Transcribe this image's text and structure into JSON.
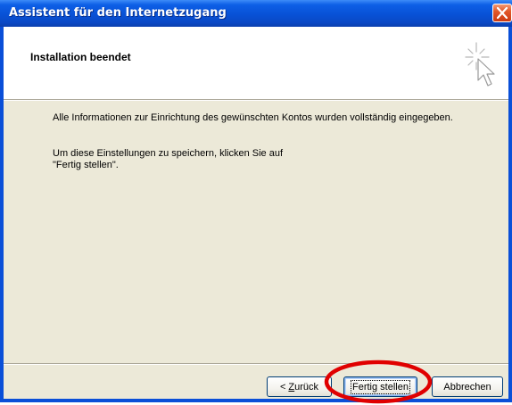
{
  "window": {
    "title": "Assistent für den Internetzugang"
  },
  "header": {
    "title": "Installation beendet",
    "icon": "wizard-cursor-icon"
  },
  "body": {
    "paragraph1": "Alle Informationen zur Einrichtung des gewünschten Kontos wurden vollständig eingegeben.",
    "paragraph2_line1": "Um diese Einstellungen zu speichern, klicken Sie auf",
    "paragraph2_line2": "\"Fertig stellen\"."
  },
  "buttons": {
    "back_accel": "Z",
    "back_rest": "urück",
    "back_prefix": "< ",
    "finish": "Fertig stellen",
    "cancel": "Abbrechen"
  },
  "annotation": {
    "color": "#e00000"
  },
  "colors": {
    "titlebar": "#0a4fd8",
    "dialog_bg": "#ece9d8",
    "close_button": "#e2582a"
  }
}
